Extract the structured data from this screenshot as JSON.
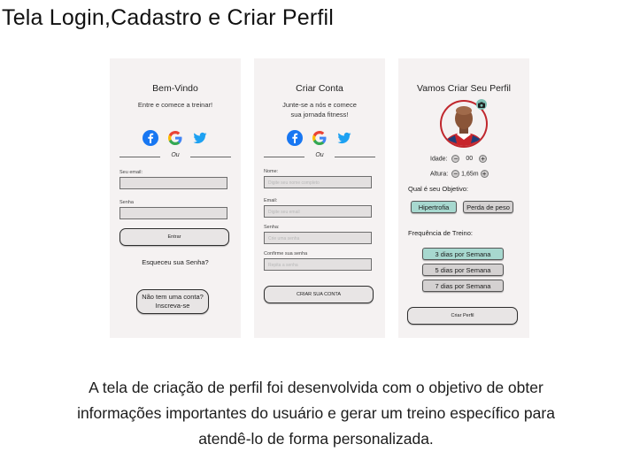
{
  "page_title": "Tela Login,Cadastro e Criar Perfil",
  "login": {
    "title": "Bem-Vindo",
    "subtitle": "Entre e comece a treinar!",
    "divider": "Ou",
    "email_label": "Seu email:",
    "password_label": "Senha",
    "submit": "Entrar",
    "forgot": "Esqueceu sua Senha?",
    "signup_line1": "Não tem uma conta?",
    "signup_line2": "Inscreva-se"
  },
  "register": {
    "title": "Criar Conta",
    "subtitle_line1": "Junte-se a nós e comece",
    "subtitle_line2": "sua jornada fitness!",
    "divider": "Ou",
    "name_label": "Nome:",
    "name_placeholder": "Digite seu nome completo",
    "email_label": "Email:",
    "email_placeholder": "Digite seu email",
    "password_label": "Senha:",
    "password_placeholder": "Crie uma senha",
    "confirm_label": "Confirme sua senha",
    "confirm_placeholder": "Repita a senha",
    "submit": "CRIAR SUA CONTA"
  },
  "profile": {
    "title": "Vamos Criar Seu Perfil",
    "age_label": "Idade:",
    "age_value": "00",
    "height_label": "Altura:",
    "height_value": "1,65m",
    "goal_label": "Qual é seu Objetivo:",
    "goals": [
      "Hipertrofia",
      "Perda de peso"
    ],
    "frequency_label": "Frequência de Treino:",
    "frequencies": [
      "3 dias por Semana",
      "5 dias por Semana",
      "7 dias por Semana"
    ],
    "submit": "Criar Perfil"
  },
  "social_icons": [
    "facebook-icon",
    "google-icon",
    "twitter-icon"
  ],
  "colors": {
    "selected": "#a7d8cf",
    "unselected": "#d4d1d1",
    "card": "#f5f2f2",
    "avatar_ring": "#c0272d",
    "camera_badge": "#7fbfb4"
  },
  "description": {
    "line1": "A tela de criação de perfil foi desenvolvida com o objetivo de obter",
    "line2": "informações importantes do usuário e gerar um treino específico para",
    "line3": "atendê-lo de forma personalizada."
  }
}
